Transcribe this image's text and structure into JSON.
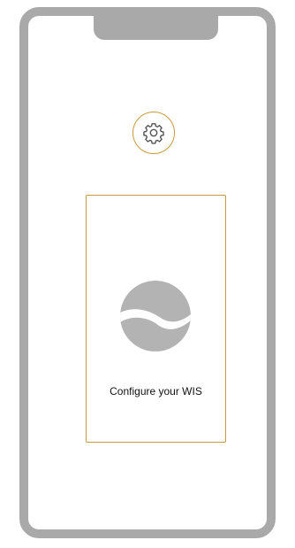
{
  "colors": {
    "frame": "#a9a9a9",
    "accent": "#c79a3e",
    "logo_fill": "#b3b3b3"
  },
  "icons": {
    "settings": "gear-icon",
    "logo": "wis-logo-icon"
  },
  "card": {
    "label": "Configure your WIS"
  }
}
